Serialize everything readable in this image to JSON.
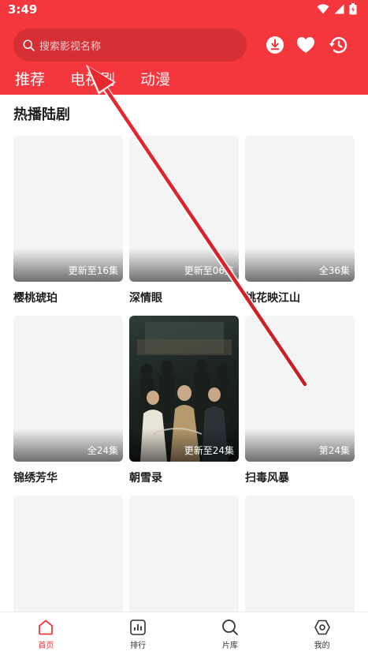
{
  "status": {
    "time": "3:49"
  },
  "search": {
    "placeholder": "搜索影视名称"
  },
  "tabs": [
    {
      "label": "推荐"
    },
    {
      "label": "电视剧"
    },
    {
      "label": "动漫"
    }
  ],
  "section": {
    "title": "热播陆剧"
  },
  "shows": [
    {
      "title": "樱桃琥珀",
      "episodes": "更新至16集"
    },
    {
      "title": "深情眼",
      "episodes": "更新至06集"
    },
    {
      "title": "桃花映江山",
      "episodes": "全36集"
    },
    {
      "title": "锦绣芳华",
      "episodes": "全24集"
    },
    {
      "title": "朝雪录",
      "episodes": "更新至24集"
    },
    {
      "title": "扫毒风暴",
      "episodes": "第24集"
    }
  ],
  "tabbar": [
    {
      "label": "首页"
    },
    {
      "label": "排行"
    },
    {
      "label": "片库"
    },
    {
      "label": "我的"
    }
  ],
  "colors": {
    "accent": "#f4363d",
    "placeholder_bg": "#f4f4f4",
    "arrow": "#e8282f"
  }
}
